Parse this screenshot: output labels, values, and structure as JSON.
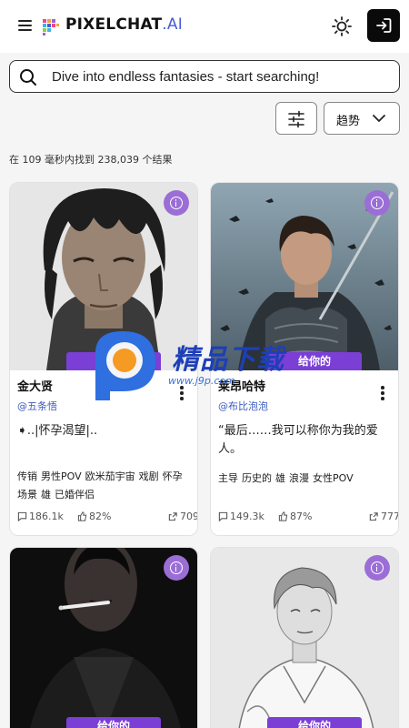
{
  "header": {
    "logo_text": "PIXELCHAT",
    "logo_suffix": ".AI",
    "menu_icon": "hamburger-icon",
    "theme_icon": "sun-icon",
    "login_icon": "sign-in-icon"
  },
  "search": {
    "placeholder": "Dive into endless fantasies - start searching!",
    "icon": "search-icon"
  },
  "controls": {
    "filter_icon": "sliders-icon",
    "sort_label": "趋势",
    "sort_icon": "chevron-down-icon"
  },
  "results_text": "在 109 毫秒内找到 238,039 个结果",
  "cards": [
    {
      "ribbon": "给你的",
      "name": "金大贤",
      "author": "@五条悟",
      "description": "➧..|怀孕渴望|..",
      "tags": [
        "传销",
        "男性POV",
        "欧米茄宇宙",
        "戏剧",
        "怀孕",
        "场景",
        "雄",
        "已婚伴侣"
      ],
      "messages": "186.1k",
      "rating": "82%",
      "shares": "709"
    },
    {
      "ribbon": "给你的",
      "name": "莱昂哈特",
      "author": "@布比泡泡",
      "description": "“最后……我可以称你为我的爱人。",
      "tags": [
        "主导",
        "历史的",
        "雄",
        "浪漫",
        "女性POV"
      ],
      "messages": "149.3k",
      "rating": "87%",
      "shares": "777"
    },
    {
      "ribbon": "给你的"
    },
    {
      "ribbon": "给你的"
    }
  ],
  "watermark": {
    "text": "精品下载",
    "url": "www.j9p.com"
  },
  "colors": {
    "accent": "#7b3fd6",
    "info_badge": "#9b6ed6",
    "link": "#3b5bbd",
    "logo_ai": "#4b5ad6"
  }
}
